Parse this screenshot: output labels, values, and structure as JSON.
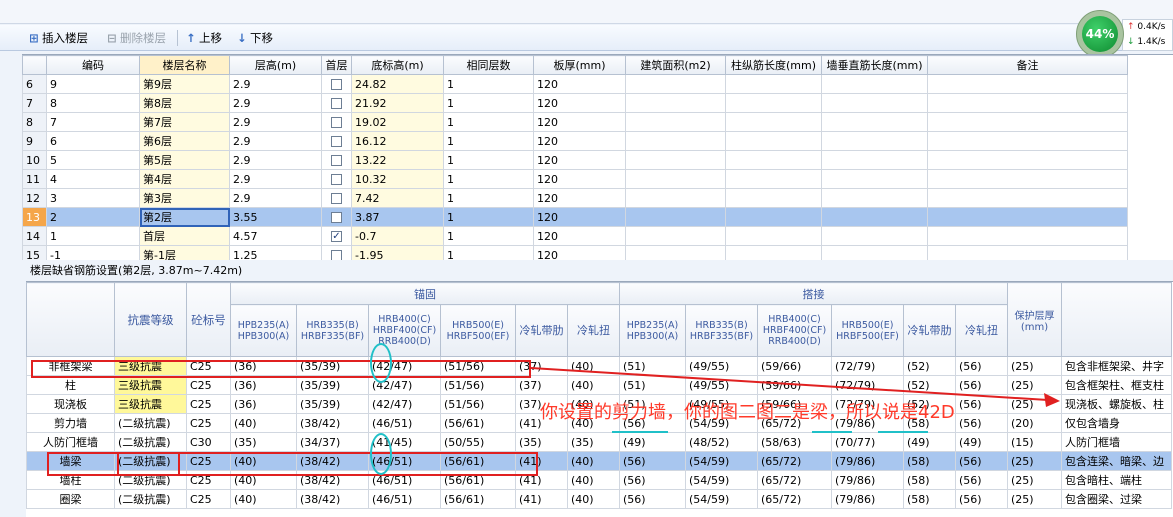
{
  "toolbar": {
    "insert_label": "插入楼层",
    "delete_label": "删除楼层",
    "up_label": "上移",
    "down_label": "下移"
  },
  "perf": {
    "percent": "44%",
    "upload": "0.4K/s",
    "download": "1.4K/s"
  },
  "floors": {
    "headers": [
      "编码",
      "楼层名称",
      "层高(m)",
      "首层",
      "底标高(m)",
      "相同层数",
      "板厚(mm)",
      "建筑面积(m2)",
      "柱纵筋长度(mm)",
      "墙垂直筋长度(mm)",
      "备注"
    ],
    "rows": [
      {
        "no": "6",
        "code": "9",
        "name": "第9层",
        "height": "2.9",
        "first": false,
        "elev": "24.82",
        "same": "1",
        "slab": "120"
      },
      {
        "no": "7",
        "code": "8",
        "name": "第8层",
        "height": "2.9",
        "first": false,
        "elev": "21.92",
        "same": "1",
        "slab": "120"
      },
      {
        "no": "8",
        "code": "7",
        "name": "第7层",
        "height": "2.9",
        "first": false,
        "elev": "19.02",
        "same": "1",
        "slab": "120"
      },
      {
        "no": "9",
        "code": "6",
        "name": "第6层",
        "height": "2.9",
        "first": false,
        "elev": "16.12",
        "same": "1",
        "slab": "120"
      },
      {
        "no": "10",
        "code": "5",
        "name": "第5层",
        "height": "2.9",
        "first": false,
        "elev": "13.22",
        "same": "1",
        "slab": "120"
      },
      {
        "no": "11",
        "code": "4",
        "name": "第4层",
        "height": "2.9",
        "first": false,
        "elev": "10.32",
        "same": "1",
        "slab": "120"
      },
      {
        "no": "12",
        "code": "3",
        "name": "第3层",
        "height": "2.9",
        "first": false,
        "elev": "7.42",
        "same": "1",
        "slab": "120"
      },
      {
        "no": "13",
        "code": "2",
        "name": "第2层",
        "height": "3.55",
        "first": false,
        "elev": "3.87",
        "same": "1",
        "slab": "120",
        "selected": true
      },
      {
        "no": "14",
        "code": "1",
        "name": "首层",
        "height": "4.57",
        "first": true,
        "elev": "-0.7",
        "same": "1",
        "slab": "120"
      },
      {
        "no": "15",
        "code": "-1",
        "name": "第-1层",
        "height": "1.25",
        "first": false,
        "elev": "-1.95",
        "same": "1",
        "slab": "120"
      }
    ]
  },
  "rebar_title": "楼层缺省钢筋设置(第2层, 3.87m~7.42m)",
  "rebar": {
    "group_anchor": "锚固",
    "group_lap": "搭接",
    "col_seismic": "抗震等级",
    "col_concrete": "砼标号",
    "col_cover": "保护层厚(mm)",
    "col_note": "",
    "sub_headers": [
      "HPB235(A) HPB300(A)",
      "HRB335(B) HRBF335(BF)",
      "HRB400(C) HRBF400(CF) RRB400(D)",
      "HRB500(E) HRBF500(EF)",
      "冷轧带肋",
      "冷轧扭",
      "HPB235(A) HPB300(A)",
      "HRB335(B) HRBF335(BF)",
      "HRB400(C) HRBF400(CF) RRB400(D)",
      "HRB500(E) HRBF500(EF)",
      "冷轧带肋",
      "冷轧扭"
    ],
    "rows": [
      {
        "name": "非框架梁",
        "grade": "三级抗震",
        "conc": "C25",
        "a": [
          "(36)",
          "(35/39)",
          "(42/47)",
          "(51/56)",
          "(37)",
          "(40)"
        ],
        "l": [
          "(51)",
          "(49/55)",
          "(59/66)",
          "(72/79)",
          "(52)",
          "(56)"
        ],
        "cover": "(25)",
        "note": "包含非框架梁、井字"
      },
      {
        "name": "柱",
        "grade": "三级抗震",
        "conc": "C25",
        "a": [
          "(36)",
          "(35/39)",
          "(42/47)",
          "(51/56)",
          "(37)",
          "(40)"
        ],
        "l": [
          "(51)",
          "(49/55)",
          "(59/66)",
          "(72/79)",
          "(52)",
          "(56)"
        ],
        "cover": "(25)",
        "note": "包含框架柱、框支柱"
      },
      {
        "name": "现浇板",
        "grade": "三级抗震",
        "conc": "C25",
        "a": [
          "(36)",
          "(35/39)",
          "(42/47)",
          "(51/56)",
          "(37)",
          "(40)"
        ],
        "l": [
          "(51)",
          "(49/55)",
          "(59/66)",
          "(72/79)",
          "(52)",
          "(56)"
        ],
        "cover": "(25)",
        "note": "现浇板、螺旋板、柱"
      },
      {
        "name": "剪力墙",
        "grade": "(二级抗震)",
        "conc": "C25",
        "a": [
          "(40)",
          "(38/42)",
          "(46/51)",
          "(56/61)",
          "(41)",
          "(40)"
        ],
        "l": [
          "(56)",
          "(54/59)",
          "(65/72)",
          "(79/86)",
          "(58)",
          "(56)"
        ],
        "cover": "(20)",
        "note": "仅包含墙身"
      },
      {
        "name": "人防门框墙",
        "grade": "(二级抗震)",
        "conc": "C30",
        "a": [
          "(35)",
          "(34/37)",
          "(41/45)",
          "(50/55)",
          "(35)",
          "(35)"
        ],
        "l": [
          "(49)",
          "(48/52)",
          "(58/63)",
          "(70/77)",
          "(49)",
          "(49)"
        ],
        "cover": "(15)",
        "note": "人防门框墙"
      },
      {
        "name": "墙梁",
        "grade": "(二级抗震)",
        "conc": "C25",
        "a": [
          "(40)",
          "(38/42)",
          "(46/51)",
          "(56/61)",
          "(41)",
          "(40)"
        ],
        "l": [
          "(56)",
          "(54/59)",
          "(65/72)",
          "(79/86)",
          "(58)",
          "(56)"
        ],
        "cover": "(25)",
        "note": "包含连梁、暗梁、边",
        "selected": true
      },
      {
        "name": "墙柱",
        "grade": "(二级抗震)",
        "conc": "C25",
        "a": [
          "(40)",
          "(38/42)",
          "(46/51)",
          "(56/61)",
          "(41)",
          "(40)"
        ],
        "l": [
          "(56)",
          "(54/59)",
          "(65/72)",
          "(79/86)",
          "(58)",
          "(56)"
        ],
        "cover": "(25)",
        "note": "包含暗柱、端柱"
      },
      {
        "name": "圈梁",
        "grade": "(二级抗震)",
        "conc": "C25",
        "a": [
          "(40)",
          "(38/42)",
          "(46/51)",
          "(56/61)",
          "(41)",
          "(40)"
        ],
        "l": [
          "(56)",
          "(54/59)",
          "(65/72)",
          "(79/86)",
          "(58)",
          "(56)"
        ],
        "cover": "(25)",
        "note": "包含圈梁、过梁"
      }
    ]
  },
  "annotation": {
    "text": "你设置的剪力墙，你的图二图二是梁，所以说是42D",
    "color": "#ff3a2a"
  }
}
